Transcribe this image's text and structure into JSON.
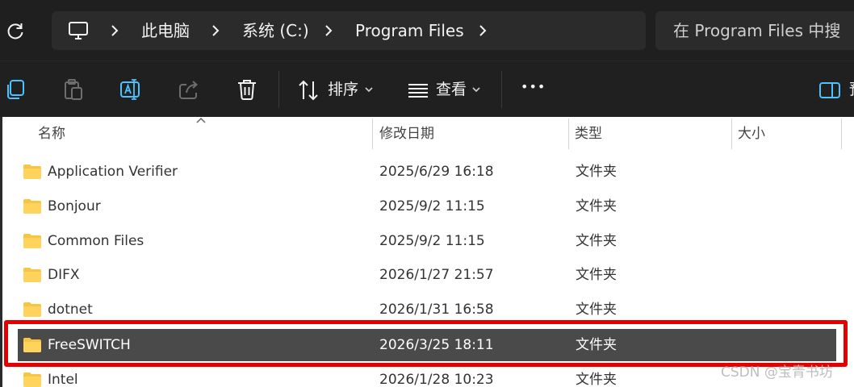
{
  "address": {
    "crumbs": [
      "此电脑",
      "系统 (C:)",
      "Program Files"
    ],
    "search_placeholder": "在 Program Files 中搜"
  },
  "toolbar": {
    "sort_label": "排序",
    "view_label": "查看",
    "more_label": "•••",
    "preview_label": "预"
  },
  "columns": {
    "name": "名称",
    "modified": "修改日期",
    "type": "类型",
    "size": "大小"
  },
  "files": [
    {
      "name": "Application Verifier",
      "modified": "2025/6/29 16:18",
      "type": "文件夹"
    },
    {
      "name": "Bonjour",
      "modified": "2025/9/2 11:15",
      "type": "文件夹"
    },
    {
      "name": "Common Files",
      "modified": "2025/9/2 11:15",
      "type": "文件夹"
    },
    {
      "name": "DIFX",
      "modified": "2026/1/27 21:57",
      "type": "文件夹"
    },
    {
      "name": "dotnet",
      "modified": "2026/1/31 16:58",
      "type": "文件夹"
    },
    {
      "name": "FreeSWITCH",
      "modified": "2026/3/25 18:11",
      "type": "文件夹",
      "selected": true
    },
    {
      "name": "Intel",
      "modified": "2026/1/28 10:23",
      "type": "文件夹"
    }
  ],
  "watermark": "CSDN @宝青书坊",
  "colors": {
    "folder": "#f6c544",
    "selected_row": "#4a4a4a",
    "highlight_box": "#e50000"
  }
}
